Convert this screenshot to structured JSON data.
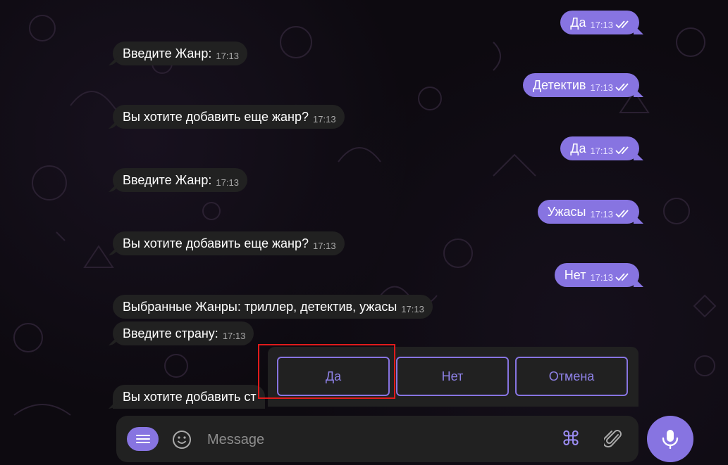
{
  "messages": [
    {
      "dir": "out",
      "text": "Да",
      "time": "17:13"
    },
    {
      "dir": "in",
      "text": "Введите Жанр:",
      "time": "17:13"
    },
    {
      "dir": "out",
      "text": "Детектив",
      "time": "17:13"
    },
    {
      "dir": "in",
      "text": "Вы хотите добавить еще жанр?",
      "time": "17:13"
    },
    {
      "dir": "out",
      "text": "Да",
      "time": "17:13"
    },
    {
      "dir": "in",
      "text": "Введите Жанр:",
      "time": "17:13"
    },
    {
      "dir": "out",
      "text": "Ужасы",
      "time": "17:13"
    },
    {
      "dir": "in",
      "text": "Вы хотите добавить еще жанр?",
      "time": "17:13"
    },
    {
      "dir": "out",
      "text": "Нет",
      "time": "17:13"
    },
    {
      "dir": "in",
      "text": "Выбранные Жанры: триллер, детектив, ужасы",
      "time": "17:13"
    },
    {
      "dir": "in",
      "text": "Введите страну:",
      "time": "17:13"
    },
    {
      "dir": "in",
      "text": "Вы хотите добавить ст",
      "time": ""
    }
  ],
  "keyboard": {
    "buttons": [
      "Да",
      "Нет",
      "Отмена"
    ]
  },
  "composer": {
    "placeholder": "Message",
    "command_icon": "⌘"
  },
  "colors": {
    "accent": "#8774e1",
    "incoming_bubble": "#212121",
    "highlight": "#e01b1b"
  },
  "icons": [
    "menu-icon",
    "emoji-icon",
    "command-icon",
    "attach-icon",
    "mic-icon",
    "double-check-icon"
  ]
}
